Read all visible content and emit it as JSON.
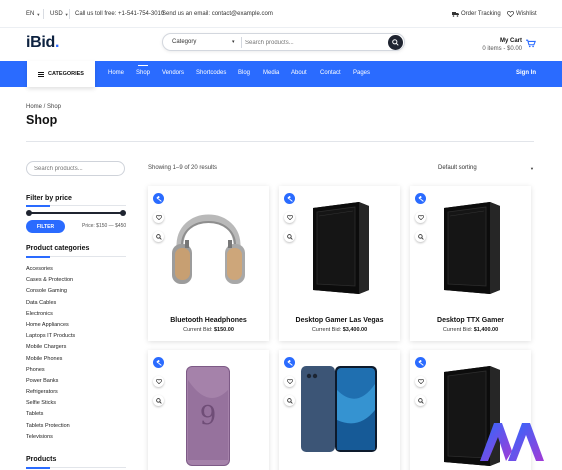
{
  "topbar": {
    "language": "EN",
    "currency": "USD",
    "phone": "Call us toll free: +1-541-754-3010",
    "email": "Send us an email: contact@example.com",
    "order_tracking": "Order Tracking",
    "wishlist": "Wishlist"
  },
  "header": {
    "logo_main": "iBid",
    "logo_dot": ".",
    "category_select": "Category",
    "search_placeholder": "Search products...",
    "cart_title": "My Cart",
    "cart_summary": "0 items - $0.00"
  },
  "nav": {
    "categories_label": "CATEGORIES",
    "links": [
      "Home",
      "Shop",
      "Vendors",
      "Shortcodes",
      "Blog",
      "Media",
      "About",
      "Contact",
      "Pages"
    ],
    "active": "Shop",
    "signin": "Sign In"
  },
  "page": {
    "breadcrumb": "Home / Shop",
    "title": "Shop"
  },
  "sidebar": {
    "search_placeholder": "Search products...",
    "filter_title": "Filter by price",
    "price_range": {
      "min": 150,
      "max": 450,
      "selected_min": 150,
      "selected_max": 450
    },
    "filter_button": "FILTER",
    "price_text": "Price: $150 — $450",
    "categories_title": "Product categories",
    "categories": [
      "Accesories",
      "Cases & Protection",
      "Console Gaming",
      "Data Cables",
      "Electronics",
      "Home Appliances",
      "Laptops IT Products",
      "Mobile Chargers",
      "Mobile Phones",
      "Phones",
      "Power Banks",
      "Refrigerators",
      "Selfie Sticks",
      "Tablets",
      "Tablets Protection",
      "Televisions"
    ],
    "products_title": "Products"
  },
  "shop": {
    "result_count": "Showing 1–9 of 20 results",
    "sorting": "Default sorting",
    "bid_label": "Current Bid:",
    "products": [
      {
        "name": "Bluetooth Headphones",
        "bid": "$150.00",
        "image": "headphones"
      },
      {
        "name": "Desktop Gamer Las Vegas",
        "bid": "$3,400.00",
        "image": "pc-tower"
      },
      {
        "name": "Desktop TTX Gamer",
        "bid": "$1,400.00",
        "image": "pc-tower"
      },
      {
        "name": "",
        "bid": "",
        "image": "phone-purple"
      },
      {
        "name": "",
        "bid": "",
        "image": "phone-blue"
      },
      {
        "name": "",
        "bid": "",
        "image": "pc-tower"
      }
    ]
  },
  "colors": {
    "accent": "#2a6bff",
    "dark": "#1f2430",
    "logo": "#0d2240"
  }
}
